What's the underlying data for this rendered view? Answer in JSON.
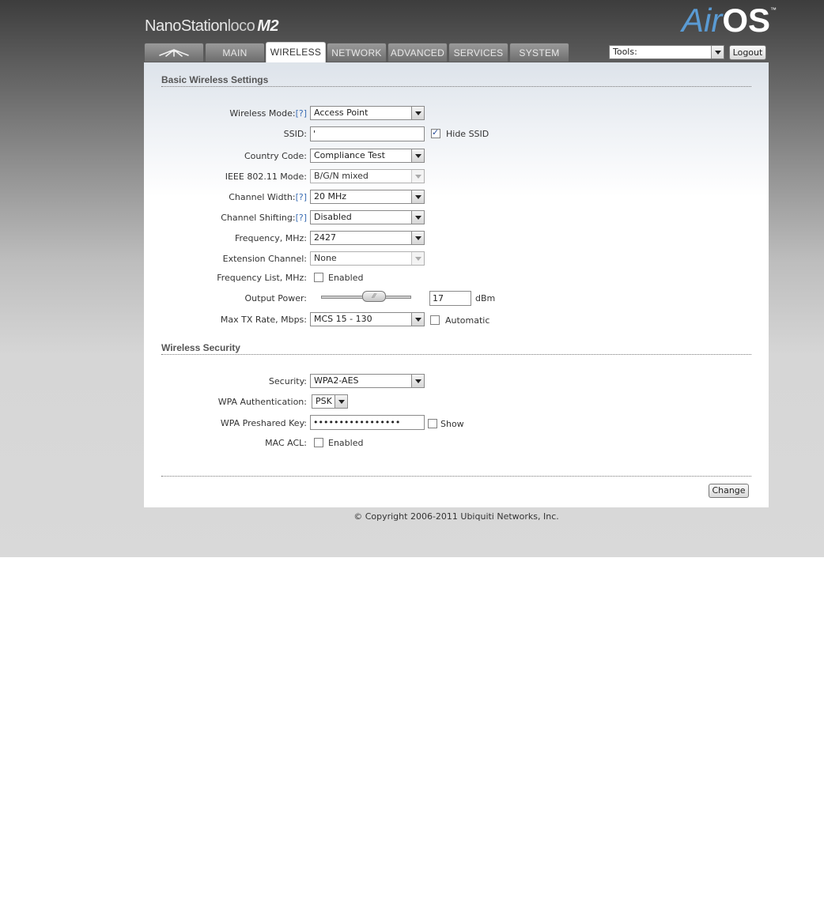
{
  "header": {
    "product_logo": {
      "name": "NanoStation",
      "sub": "loco",
      "model": "M2"
    },
    "brand_logo": {
      "air": "Air",
      "os": "OS",
      "tm": "™"
    },
    "tabs": [
      {
        "label": "",
        "icon": "ubiquiti-logo-icon"
      },
      {
        "label": "MAIN"
      },
      {
        "label": "WIRELESS",
        "active": true
      },
      {
        "label": "NETWORK"
      },
      {
        "label": "ADVANCED"
      },
      {
        "label": "SERVICES"
      },
      {
        "label": "SYSTEM"
      }
    ],
    "tools": {
      "value": "Tools:"
    },
    "logout_label": "Logout"
  },
  "basic": {
    "title": "Basic Wireless Settings",
    "wireless_mode": {
      "label": "Wireless Mode:",
      "help": "[?]",
      "value": "Access Point"
    },
    "ssid": {
      "label": "SSID:",
      "value": "'",
      "hide_label": "Hide SSID",
      "hide_checked": true
    },
    "country_code": {
      "label": "Country Code:",
      "value": "Compliance Test"
    },
    "ieee_mode": {
      "label": "IEEE 802.11 Mode:",
      "value": "B/G/N mixed"
    },
    "channel_width": {
      "label": "Channel Width:",
      "help": "[?]",
      "value": "20 MHz"
    },
    "channel_shifting": {
      "label": "Channel Shifting:",
      "help": "[?]",
      "value": "Disabled"
    },
    "frequency": {
      "label": "Frequency, MHz:",
      "value": "2427"
    },
    "extension_channel": {
      "label": "Extension Channel:",
      "value": "None"
    },
    "frequency_list": {
      "label": "Frequency List, MHz:",
      "enabled_label": "Enabled",
      "checked": false
    },
    "output_power": {
      "label": "Output Power:",
      "value": "17",
      "unit": "dBm",
      "level": 0.62
    },
    "max_tx_rate": {
      "label": "Max TX Rate, Mbps:",
      "value": "MCS 15 - 130",
      "auto_label": "Automatic",
      "auto_checked": false
    }
  },
  "security": {
    "title": "Wireless Security",
    "security": {
      "label": "Security:",
      "value": "WPA2-AES"
    },
    "wpa_auth": {
      "label": "WPA Authentication:",
      "value": "PSK"
    },
    "wpa_key": {
      "label": "WPA Preshared Key:",
      "value": "•••••••••••••••••",
      "show_label": "Show",
      "show_checked": false
    },
    "mac_acl": {
      "label": "MAC ACL:",
      "enabled_label": "Enabled",
      "checked": false
    }
  },
  "footer": {
    "change_label": "Change",
    "copyright": "© Copyright 2006-2011 Ubiquiti Networks, Inc."
  }
}
